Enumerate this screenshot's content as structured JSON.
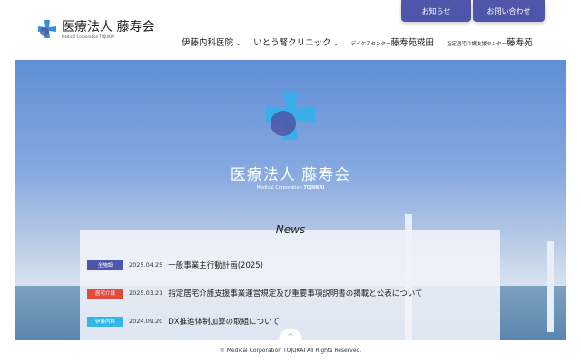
{
  "header": {
    "logo_title": "医療法人 藤寿会",
    "logo_sub": "Medical Corporation TOJUKAI",
    "top_buttons": [
      "お知らせ",
      "お問い合わせ"
    ],
    "nav": [
      {
        "label": "伊藤内科医院",
        "dropdown": true
      },
      {
        "label": "いとう腎クリニック",
        "dropdown": true
      },
      {
        "prefix": "デイケアセンター",
        "label": "藤寿苑糀田"
      },
      {
        "prefix": "指定居宅介護支援センター",
        "label": "藤寿苑"
      }
    ]
  },
  "hero": {
    "title": "医療法人 藤寿会",
    "subtitle_a": "Medical Corporation ",
    "subtitle_b": "TOJUKAI"
  },
  "news": {
    "title": "News",
    "items": [
      {
        "badge": "全施設",
        "color": "#4f55a8",
        "date": "2025.04.25",
        "text": "一般事業主行動計画(2025)"
      },
      {
        "badge": "居宅介護",
        "color": "#e04b3c",
        "date": "2025.03.21",
        "text": "指定居宅介護支援事業運営規定及び重要事項説明書の掲載と公表について"
      },
      {
        "badge": "伊藤内科",
        "color": "#33b5e5",
        "date": "2024.09.20",
        "text": "DX推進体制加算の取組について"
      }
    ]
  },
  "footer": {
    "copyright": "© Medical Corporation TOJUKAI All Rights Reserved."
  },
  "icons": {
    "logo": "cross-logo-icon",
    "totop": "chevron-up-icon"
  }
}
